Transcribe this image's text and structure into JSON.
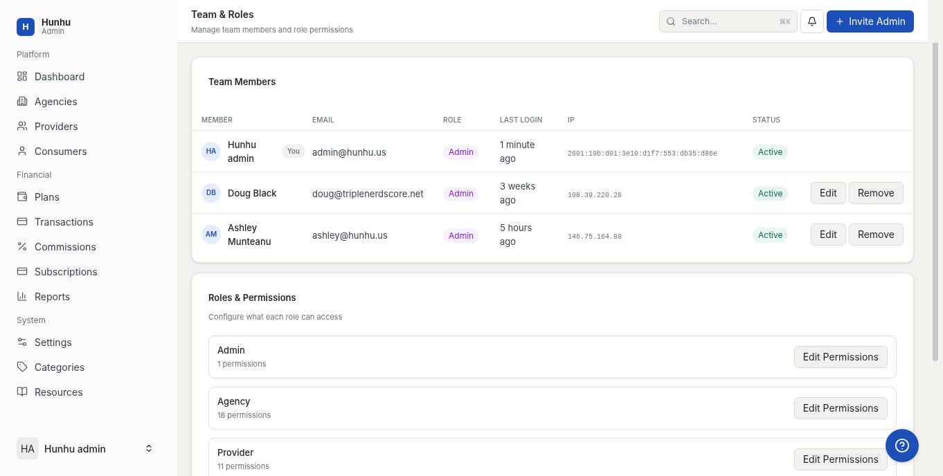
{
  "brand": {
    "logo": "H",
    "name": "Hunhu",
    "subtitle": "Admin"
  },
  "sidebar": {
    "sections": [
      {
        "title": "Platform",
        "items": [
          {
            "label": "Dashboard"
          },
          {
            "label": "Agencies"
          },
          {
            "label": "Providers"
          },
          {
            "label": "Consumers"
          }
        ]
      },
      {
        "title": "Financial",
        "items": [
          {
            "label": "Plans"
          },
          {
            "label": "Transactions"
          },
          {
            "label": "Commissions"
          },
          {
            "label": "Subscriptions"
          },
          {
            "label": "Reports"
          }
        ]
      },
      {
        "title": "System",
        "items": [
          {
            "label": "Settings"
          },
          {
            "label": "Categories"
          },
          {
            "label": "Resources"
          }
        ]
      }
    ],
    "user": {
      "initials": "HA",
      "name": "Hunhu admin"
    }
  },
  "header": {
    "title": "Team & Roles",
    "subtitle": "Manage team members and role permissions",
    "search": {
      "placeholder": "Search...",
      "shortcut": "⌘K"
    },
    "invite_button": "Invite Admin"
  },
  "team": {
    "title": "Team Members",
    "columns": [
      "MEMBER",
      "EMAIL",
      "ROLE",
      "LAST LOGIN",
      "IP",
      "STATUS"
    ],
    "rows": [
      {
        "initials": "HA",
        "name": "Hunhu admin",
        "you_badge": "You",
        "email": "admin@hunhu.us",
        "role": "Admin",
        "last_login": "1 minute ago",
        "ip": "2601:19b:d01:3e10:d1f7:553:db35:d86e",
        "status": "Active",
        "actions": []
      },
      {
        "initials": "DB",
        "name": "Doug Black",
        "email": "doug@triplenerdscore.net",
        "role": "Admin",
        "last_login": "3 weeks ago",
        "ip": "108.39.220.26",
        "status": "Active",
        "actions": [
          "Edit",
          "Remove"
        ]
      },
      {
        "initials": "AM",
        "name": "Ashley Munteanu",
        "email": "ashley@hunhu.us",
        "role": "Admin",
        "last_login": "5 hours ago",
        "ip": "146.75.164.88",
        "status": "Active",
        "actions": [
          "Edit",
          "Remove"
        ]
      }
    ]
  },
  "roles": {
    "title": "Roles & Permissions",
    "subtitle": "Configure what each role can access",
    "items": [
      {
        "name": "Admin",
        "count": "1 permissions",
        "button": "Edit Permissions"
      },
      {
        "name": "Agency",
        "count": "18 permissions",
        "button": "Edit Permissions"
      },
      {
        "name": "Provider",
        "count": "11 permissions",
        "button": "Edit Permissions"
      }
    ]
  }
}
